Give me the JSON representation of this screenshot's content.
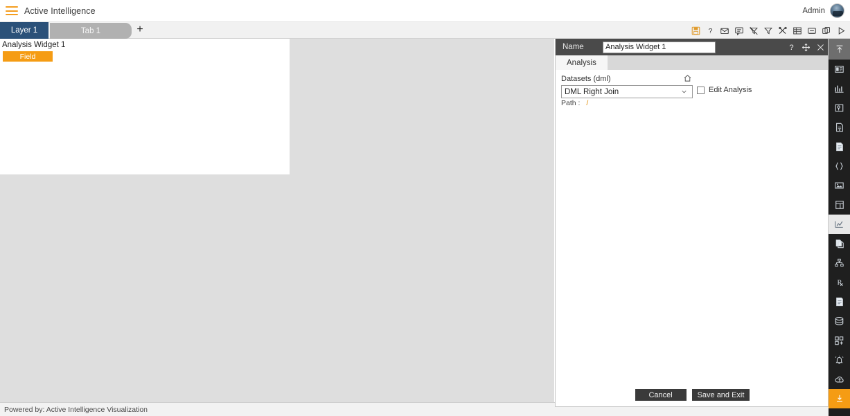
{
  "topbar": {
    "menu_icon": "hamburger-icon",
    "app_title": "Active Intelligence",
    "user_label": "Admin",
    "avatar_icon": "user-avatar-icon"
  },
  "tabstrip": {
    "layer_tab": "Layer 1",
    "page_tab": "Tab 1",
    "add_tab": "+",
    "tool_icons": [
      {
        "name": "save-icon",
        "title": "Save"
      },
      {
        "name": "help-icon",
        "title": "Help"
      },
      {
        "name": "mail-icon",
        "title": "Mail"
      },
      {
        "name": "comment-icon",
        "title": "Comment"
      },
      {
        "name": "clear-filter-icon",
        "title": "Clear Filter"
      },
      {
        "name": "filter-icon",
        "title": "Filter"
      },
      {
        "name": "tools-icon",
        "title": "Tools"
      },
      {
        "name": "table-icon",
        "title": "Table"
      },
      {
        "name": "console-icon",
        "title": "Console"
      },
      {
        "name": "copy-icon",
        "title": "Copy"
      },
      {
        "name": "play-icon",
        "title": "Run"
      }
    ]
  },
  "canvas": {
    "widget": {
      "title": "Analysis Widget 1",
      "field_chip": "Field"
    }
  },
  "statusbar": {
    "text": "Powered by: Active Intelligence Visualization"
  },
  "panel": {
    "header": {
      "name_label": "Name",
      "name_value": "Analysis Widget 1",
      "name_placeholder": "Name",
      "help_icon": "question-mark-icon",
      "move_icon": "move-icon",
      "close_icon": "close-icon"
    },
    "tabs": [
      {
        "label": "Analysis",
        "active": true
      }
    ],
    "form": {
      "datasets_label": "Datasets (dml)",
      "home_icon": "home-icon",
      "dataset_value": "DML Right Join",
      "dataset_options": [
        "DML Right Join"
      ],
      "edit_analysis_label": "Edit Analysis",
      "edit_analysis_checked": false,
      "path_label": "Path :",
      "path_value": "/"
    },
    "footer": {
      "cancel_label": "Cancel",
      "save_label": "Save and Exit"
    }
  },
  "rail": {
    "items": [
      {
        "name": "collapse-up-icon",
        "state": "top"
      },
      {
        "name": "widget-icon",
        "state": "normal"
      },
      {
        "name": "chart-icon",
        "state": "normal"
      },
      {
        "name": "map-icon",
        "state": "normal"
      },
      {
        "name": "document-data-icon",
        "state": "normal"
      },
      {
        "name": "page-icon",
        "state": "normal"
      },
      {
        "name": "code-braces-icon",
        "state": "normal"
      },
      {
        "name": "image-icon",
        "state": "normal"
      },
      {
        "name": "grid-layout-icon",
        "state": "normal"
      },
      {
        "name": "analysis-chart-icon",
        "state": "selected"
      },
      {
        "name": "copy-page-icon",
        "state": "normal"
      },
      {
        "name": "hierarchy-icon",
        "state": "normal"
      },
      {
        "name": "prescription-icon",
        "state": "normal"
      },
      {
        "name": "report-icon",
        "state": "normal"
      },
      {
        "name": "database-icon",
        "state": "normal"
      },
      {
        "name": "add-module-icon",
        "state": "normal"
      },
      {
        "name": "alert-bell-icon",
        "state": "normal"
      },
      {
        "name": "cloud-upload-icon",
        "state": "normal"
      },
      {
        "name": "download-icon",
        "state": "accent"
      }
    ]
  },
  "colors": {
    "accent": "#f59c14",
    "layer_tab": "#2b5179",
    "panel_header": "#4a4a4a",
    "rail_bg": "#1f1f1f",
    "canvas_bg": "#dedede"
  }
}
